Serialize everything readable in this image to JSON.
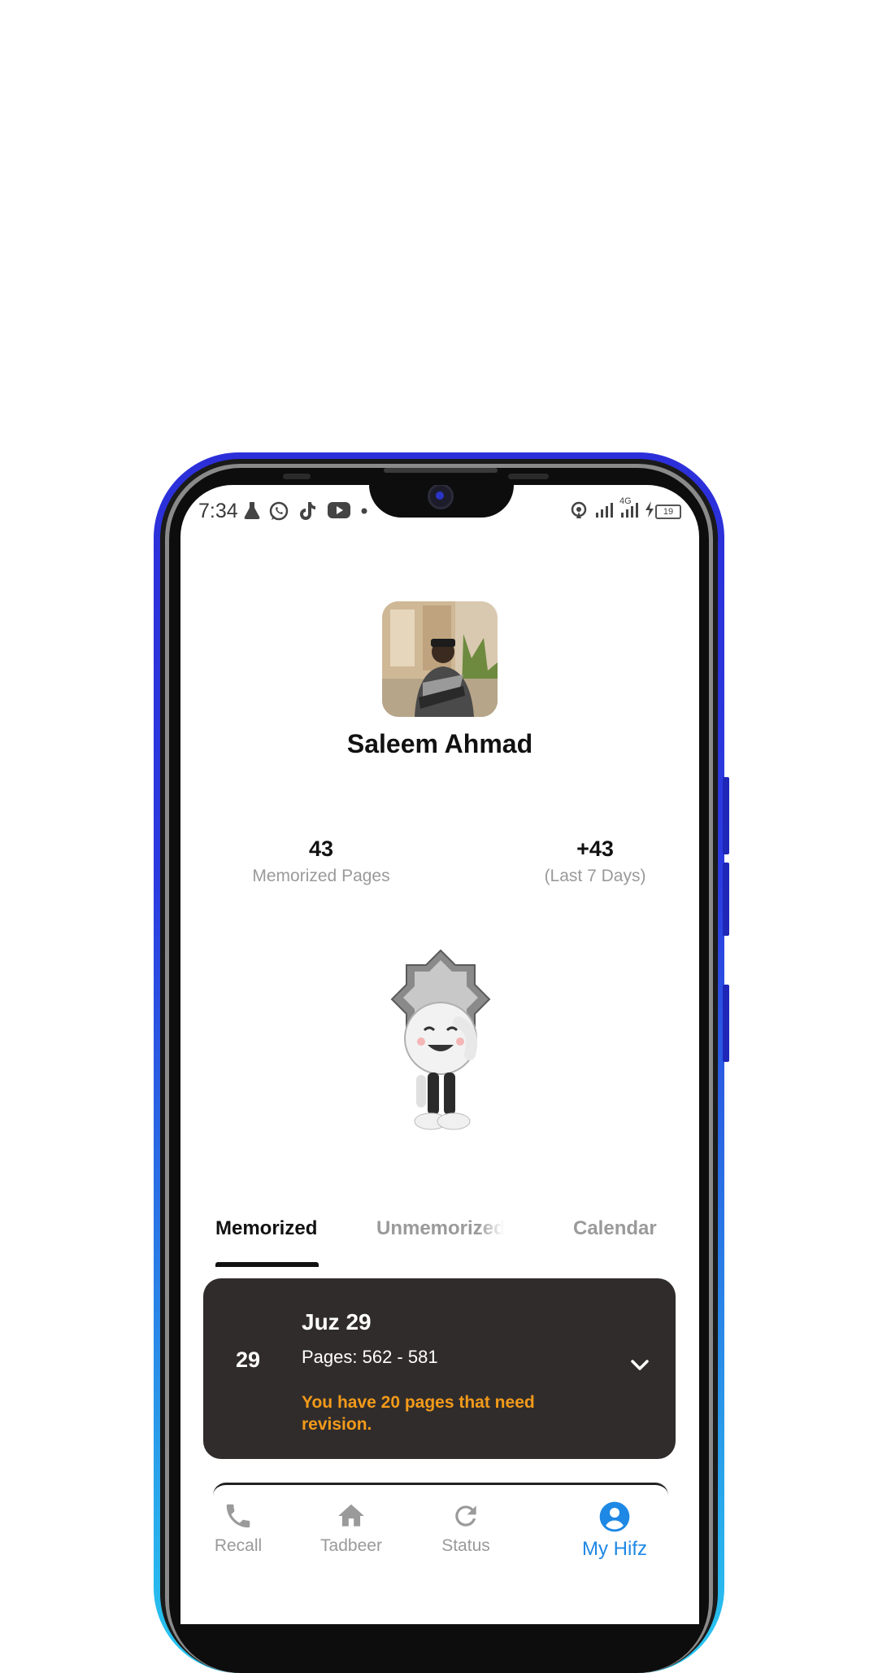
{
  "status_bar": {
    "time": "7:34",
    "network": "4G",
    "battery": "19"
  },
  "profile": {
    "name": "Saleem Ahmad",
    "avatar_icon": "user-photo"
  },
  "stats": {
    "memorized_value": "43",
    "memorized_label": "Memorized Pages",
    "recent_value": "+43",
    "recent_label": "(Last 7 Days)"
  },
  "tabs": [
    {
      "label": "Memorized",
      "active": true
    },
    {
      "label": "Unmemorized",
      "active": false
    },
    {
      "label": "Calendar",
      "active": false
    }
  ],
  "juz_card": {
    "number": "29",
    "title": "Juz 29",
    "pages": "Pages: 562 - 581",
    "warning": "You have 20 pages that need revision.",
    "background": "#302c2b",
    "warning_color": "#f29a1a"
  },
  "bottom_nav": [
    {
      "label": "Recall",
      "icon": "phone-icon",
      "active": false
    },
    {
      "label": "Tadbeer",
      "icon": "home-icon",
      "active": false
    },
    {
      "label": "Status",
      "icon": "refresh-icon",
      "active": false
    },
    {
      "label": "My Hifz",
      "icon": "account-circle-icon",
      "active": true
    }
  ],
  "accent_color": "#1e88e5"
}
